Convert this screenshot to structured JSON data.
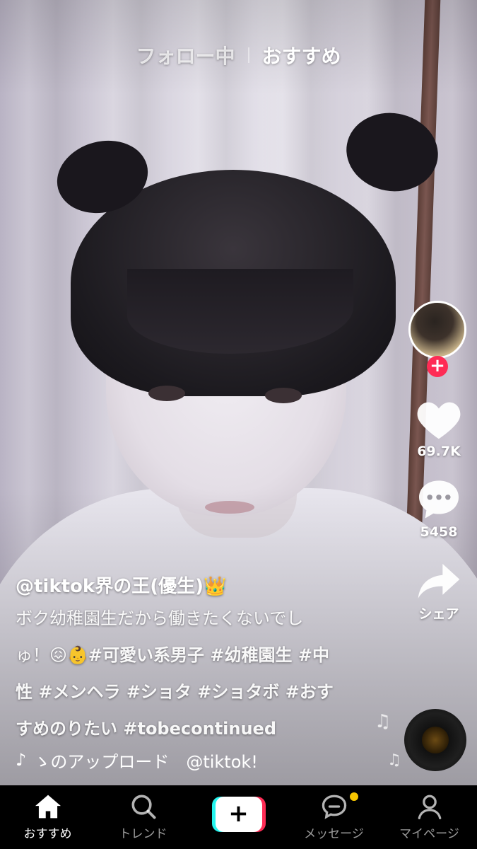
{
  "top_tabs": {
    "following": "フォロー中",
    "for_you": "おすすめ"
  },
  "right_rail": {
    "like_count": "69.7K",
    "comment_count": "5458",
    "share_label": "シェア",
    "follow_symbol": "+"
  },
  "caption": {
    "username": "@tiktok界の王(優生)👑",
    "desc_line1": "ボク幼稚園生だから働きたくないでし",
    "desc_line2_text": "ゅ！😖👶",
    "desc_line2_tags": "#可愛い系男子 #幼稚園生 #中",
    "desc_line3": "性 #メンヘラ #ショタ #ショタボ #おす",
    "desc_line4_text": "すめのりたい ",
    "desc_line4_tags": "#tobecontinued"
  },
  "sound": {
    "icon": "♪",
    "text": "ゝのアップロード　@tiktok!"
  },
  "bottom_nav": {
    "home": "おすすめ",
    "discover": "トレンド",
    "create": "+",
    "inbox": "メッセージ",
    "profile": "マイページ"
  },
  "colors": {
    "accent_red": "#fe2c55",
    "accent_cyan": "#25f4ee",
    "badge_yellow": "#f7c600"
  },
  "icons": [
    "heart-icon",
    "comment-icon",
    "share-arrow-icon",
    "music-note-icon",
    "home-icon",
    "search-icon",
    "inbox-icon",
    "profile-icon"
  ]
}
